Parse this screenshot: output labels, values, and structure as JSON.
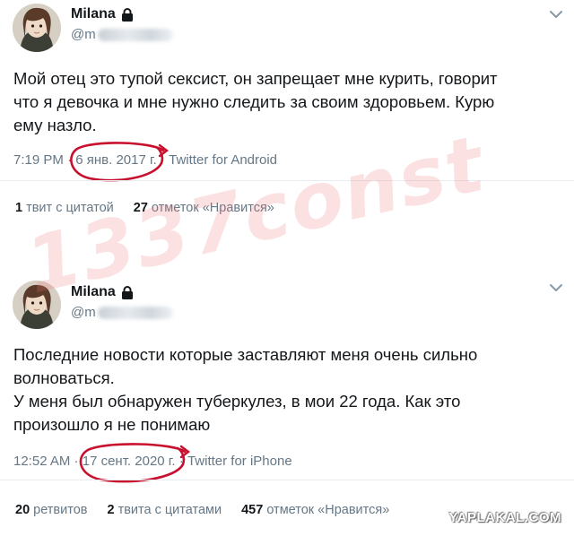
{
  "tweets": [
    {
      "author_name": "Milana",
      "handle_prefix": "@m",
      "body_lines": [
        "Мой отец это тупой сексист, он запрещает мне курить, говорит",
        "что я девочка и мне нужно следить за своим здоровьем. Курю",
        "ему назло."
      ],
      "time": "7:19 PM",
      "sep1": " · ",
      "date": "6 янв. 2017 г.",
      "sep2": " · ",
      "client": "Twitter for Android",
      "stats": [
        {
          "count": "1",
          "label": "твит с цитатой"
        },
        {
          "count": "27",
          "label": "отметок «Нравится»"
        }
      ]
    },
    {
      "author_name": "Milana",
      "handle_prefix": "@m",
      "body_lines": [
        "Последние новости которые заставляют меня очень сильно",
        "волноваться.",
        "У меня был обнаружен туберкулез, в мои 22 года. Как это",
        "произошло я не понимаю"
      ],
      "time": "12:52 AM",
      "sep1": " · ",
      "date": "17 сент. 2020 г.",
      "sep2": " · ",
      "client": "Twitter for iPhone",
      "stats": [
        {
          "count": "20",
          "label": "ретвитов"
        },
        {
          "count": "2",
          "label": "твита с цитатами"
        },
        {
          "count": "457",
          "label": "отметок «Нравится»"
        }
      ]
    }
  ],
  "watermark_text": "1337const",
  "site_watermark": "YAPLAKAL.COM",
  "colors": {
    "text": "#14171a",
    "secondary": "#657786",
    "divider": "#e6ecf0",
    "annotation_circle": "#c8102e",
    "watermark": "#eb7878"
  },
  "icons": [
    "lock-icon",
    "chevron-down-icon",
    "avatar-image"
  ]
}
